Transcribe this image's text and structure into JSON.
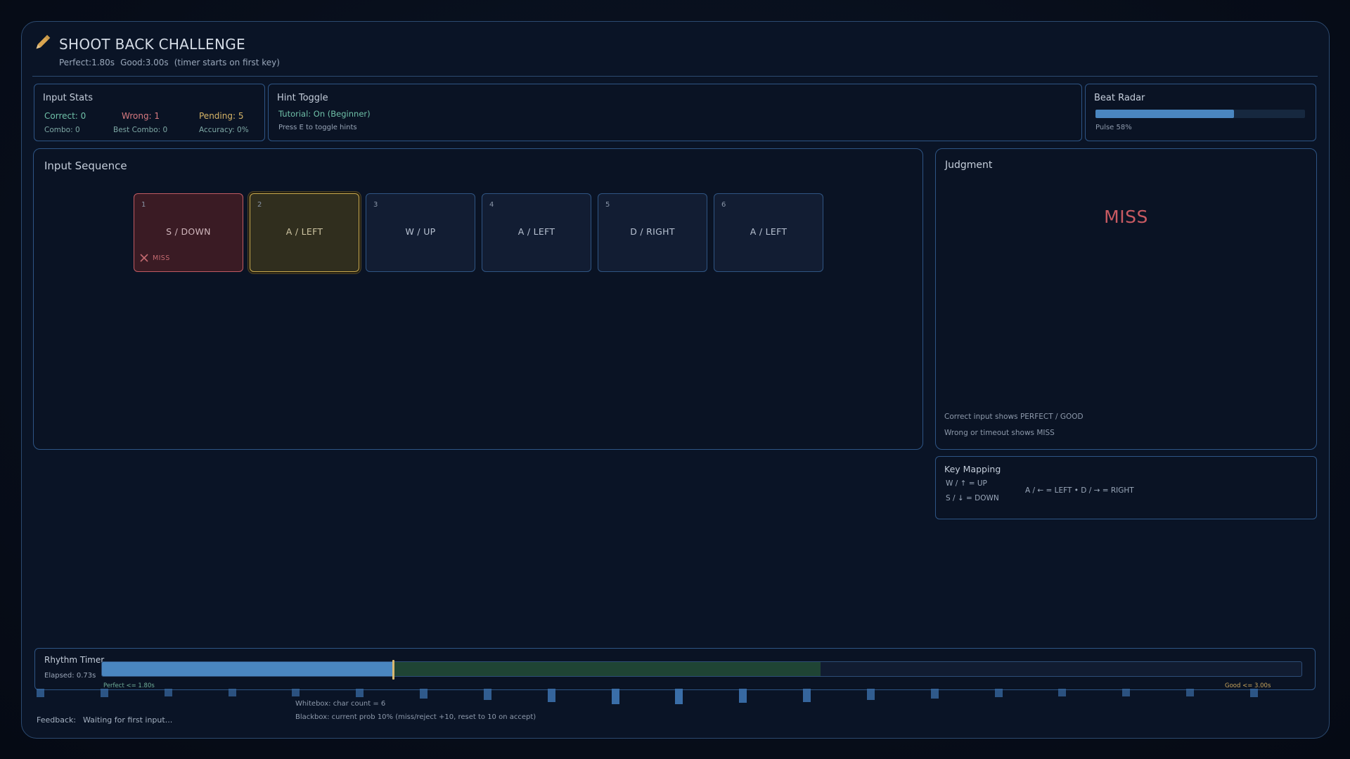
{
  "header": {
    "title": "SHOOT BACK CHALLENGE",
    "perfect": "Perfect:1.80s",
    "good": "Good:3.00s",
    "timer_note": "(timer starts on first key)"
  },
  "stats": {
    "title": "Input Stats",
    "correct": "Correct: 0",
    "wrong": "Wrong: 1",
    "pending": "Pending: 5",
    "combo": "Combo: 0",
    "best_combo": "Best Combo: 0",
    "accuracy": "Accuracy: 0%"
  },
  "hint": {
    "title": "Hint Toggle",
    "status": "Tutorial: On (Beginner)",
    "help": "Press E to toggle hints"
  },
  "beat": {
    "title": "Beat Radar",
    "pulse_label": "Pulse 58%",
    "pulse": 0.66
  },
  "sequence": {
    "title": "Input Sequence",
    "items": [
      {
        "num": "1",
        "label": "S / DOWN",
        "state": "miss",
        "tag": "MISS"
      },
      {
        "num": "2",
        "label": "A / LEFT",
        "state": "active"
      },
      {
        "num": "3",
        "label": "W / UP",
        "state": "pending"
      },
      {
        "num": "4",
        "label": "A / LEFT",
        "state": "pending"
      },
      {
        "num": "5",
        "label": "D / RIGHT",
        "state": "pending"
      },
      {
        "num": "6",
        "label": "A / LEFT",
        "state": "pending"
      }
    ]
  },
  "judgment": {
    "title": "Judgment",
    "result": "MISS",
    "note1": "Correct input shows PERFECT / GOOD",
    "note2": "Wrong or timeout shows MISS"
  },
  "mapping": {
    "title": "Key Mapping",
    "up": "W / ↑  = UP",
    "down": "S / ↓  = DOWN",
    "lr": "A / ← = LEFT   •   D / → = RIGHT"
  },
  "rhythm": {
    "title": "Rhythm Timer",
    "elapsed": "Elapsed: 0.73s",
    "perfect_label": "Perfect <= 1.80s",
    "good_label": "Good <= 3.00s",
    "elapsed_fraction": 0.243,
    "perfect_fraction": 0.243,
    "good_fraction": 0.599,
    "tick_levels": [
      0.4,
      0.4,
      0.3,
      0.3,
      0.3,
      0.4,
      0.5,
      0.6,
      0.8,
      1.0,
      1.0,
      0.9,
      0.8,
      0.6,
      0.5,
      0.4,
      0.3,
      0.3,
      0.3,
      0.4
    ]
  },
  "footer": {
    "feedback_label": "Feedback:",
    "feedback_value": "Waiting for first input...",
    "whitebox": "Whitebox: char count = 6",
    "blackbox": "Blackbox: current prob 10% (miss/reject +10, reset to 10 on accept)"
  },
  "colors": {
    "accent": "#4a86c0",
    "miss": "#c85a62",
    "correct": "#6fc0a8",
    "wrong": "#d87a80",
    "pending": "#d6b466",
    "active": "#c9a94f"
  }
}
